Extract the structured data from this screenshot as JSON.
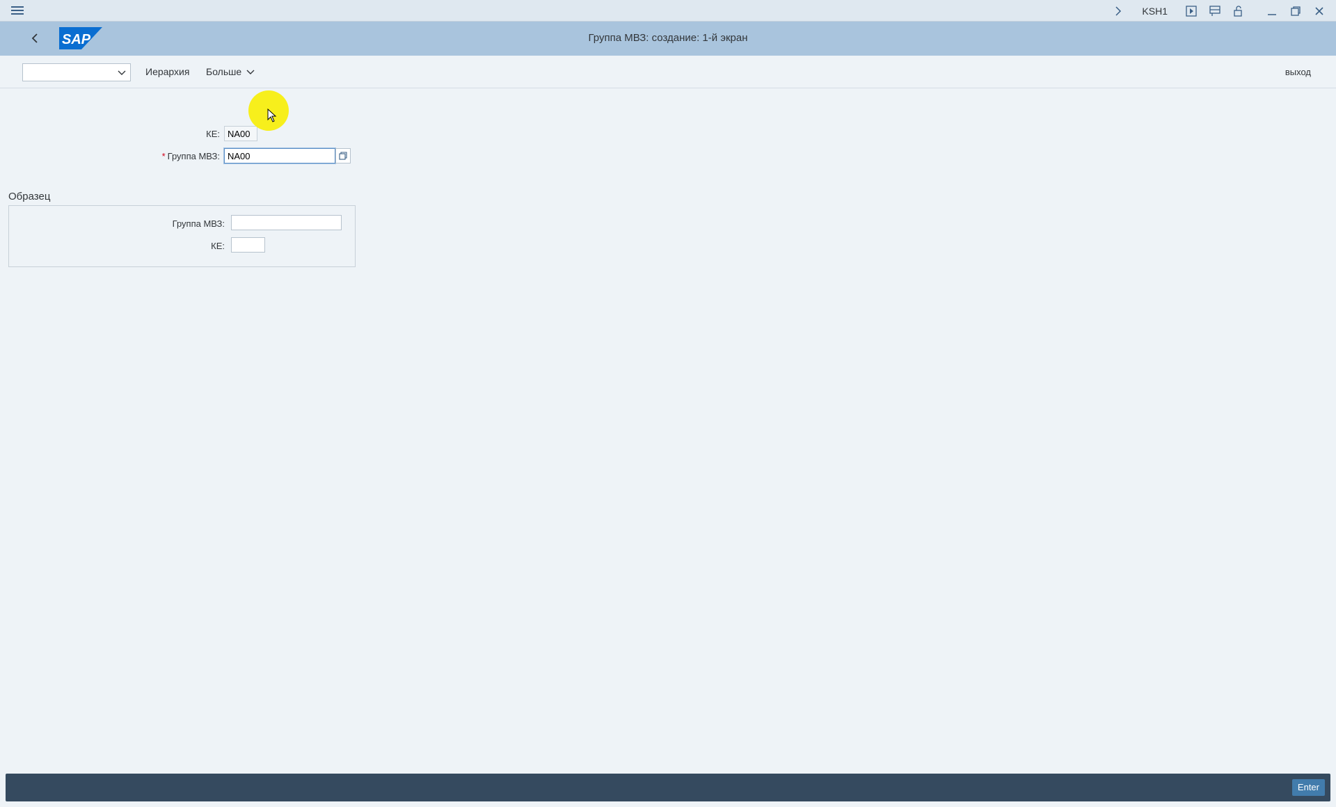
{
  "system_bar": {
    "tcode": "KSH1",
    "icons": [
      "menu-icon",
      "chevron-right-icon",
      "play-icon",
      "layout-icon",
      "lock-icon",
      "minimize-icon",
      "restore-icon",
      "close-icon"
    ]
  },
  "title_bar": {
    "title": "Группа МВЗ: создание: 1-й экран",
    "logo_text": "SAP",
    "colors": {
      "bar": "#a9c4dd",
      "logo": "#0a6ed1"
    }
  },
  "toolbar": {
    "command_field_value": "",
    "hierarchy_label": "Иерархия",
    "more_label": "Больше",
    "exit_label": "выход"
  },
  "form": {
    "ke_label": "КЕ:",
    "ke_value": "NA00",
    "group_label": "Группа МВЗ:",
    "group_value": "NA00"
  },
  "template_section": {
    "title": "Образец",
    "group_label": "Группа МВЗ:",
    "group_value": "",
    "ke_label": "КЕ:",
    "ke_value": ""
  },
  "status_bar": {
    "enter_label": "Enter"
  }
}
